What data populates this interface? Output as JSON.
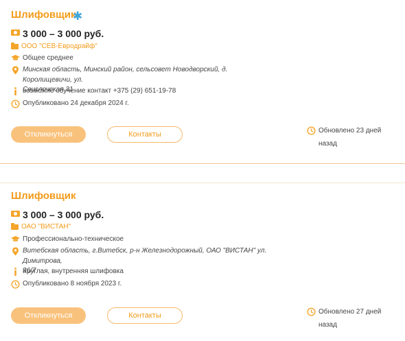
{
  "listings": [
    {
      "title": "Шлифовщик",
      "salary": "3 000 – 3 000 руб.",
      "company": "ООО \"СЕВ-Евродрайф\"",
      "education": "Общее среднее",
      "address_line1": "Минская область, Минский район, сельсовет Новодворский, д. Королищевичи, ул.",
      "address_line2": "Свислочская 31",
      "info": "возможно обучение контакт +375 (29) 651-19-78",
      "published": "Опубликовано 24 декабря 2024 г.",
      "apply_label": "Откликнуться",
      "contacts_label": "Контакты",
      "updated_line1": "Обновлено 23 дней",
      "updated_line2": "назад"
    },
    {
      "title": "Шлифовщик",
      "salary": "3 000 – 3 000 руб.",
      "company": "ОАО \"ВИСТАН\"",
      "education": "Профессионально-техническое",
      "address_line1": "Витебская область, г.Витебск, р-н Железнодорожный, ОАО \"ВИСТАН\" ул. Димитрова,",
      "address_line2": "36/7",
      "info": "Круглая, внутренняя шлифовка",
      "published": "Опубликовано 8 ноября 2023 г.",
      "apply_label": "Откликнуться",
      "contacts_label": "Контакты",
      "updated_line1": "Обновлено 27 дней",
      "updated_line2": "назад"
    }
  ],
  "colors": {
    "accent": "#f39b1a",
    "button_fill": "#f9c27c",
    "star": "#3ea6d9"
  }
}
